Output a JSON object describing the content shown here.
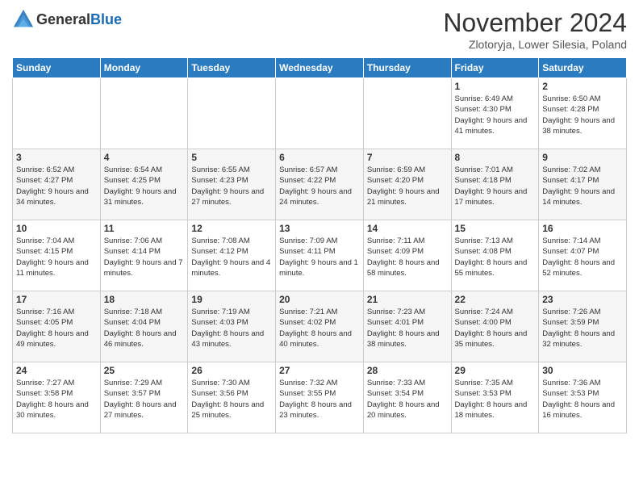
{
  "header": {
    "logo_general": "General",
    "logo_blue": "Blue",
    "month_title": "November 2024",
    "subtitle": "Zlotoryja, Lower Silesia, Poland"
  },
  "weekdays": [
    "Sunday",
    "Monday",
    "Tuesday",
    "Wednesday",
    "Thursday",
    "Friday",
    "Saturday"
  ],
  "weeks": [
    [
      {
        "day": "",
        "info": ""
      },
      {
        "day": "",
        "info": ""
      },
      {
        "day": "",
        "info": ""
      },
      {
        "day": "",
        "info": ""
      },
      {
        "day": "",
        "info": ""
      },
      {
        "day": "1",
        "info": "Sunrise: 6:49 AM\nSunset: 4:30 PM\nDaylight: 9 hours and 41 minutes."
      },
      {
        "day": "2",
        "info": "Sunrise: 6:50 AM\nSunset: 4:28 PM\nDaylight: 9 hours and 38 minutes."
      }
    ],
    [
      {
        "day": "3",
        "info": "Sunrise: 6:52 AM\nSunset: 4:27 PM\nDaylight: 9 hours and 34 minutes."
      },
      {
        "day": "4",
        "info": "Sunrise: 6:54 AM\nSunset: 4:25 PM\nDaylight: 9 hours and 31 minutes."
      },
      {
        "day": "5",
        "info": "Sunrise: 6:55 AM\nSunset: 4:23 PM\nDaylight: 9 hours and 27 minutes."
      },
      {
        "day": "6",
        "info": "Sunrise: 6:57 AM\nSunset: 4:22 PM\nDaylight: 9 hours and 24 minutes."
      },
      {
        "day": "7",
        "info": "Sunrise: 6:59 AM\nSunset: 4:20 PM\nDaylight: 9 hours and 21 minutes."
      },
      {
        "day": "8",
        "info": "Sunrise: 7:01 AM\nSunset: 4:18 PM\nDaylight: 9 hours and 17 minutes."
      },
      {
        "day": "9",
        "info": "Sunrise: 7:02 AM\nSunset: 4:17 PM\nDaylight: 9 hours and 14 minutes."
      }
    ],
    [
      {
        "day": "10",
        "info": "Sunrise: 7:04 AM\nSunset: 4:15 PM\nDaylight: 9 hours and 11 minutes."
      },
      {
        "day": "11",
        "info": "Sunrise: 7:06 AM\nSunset: 4:14 PM\nDaylight: 9 hours and 7 minutes."
      },
      {
        "day": "12",
        "info": "Sunrise: 7:08 AM\nSunset: 4:12 PM\nDaylight: 9 hours and 4 minutes."
      },
      {
        "day": "13",
        "info": "Sunrise: 7:09 AM\nSunset: 4:11 PM\nDaylight: 9 hours and 1 minute."
      },
      {
        "day": "14",
        "info": "Sunrise: 7:11 AM\nSunset: 4:09 PM\nDaylight: 8 hours and 58 minutes."
      },
      {
        "day": "15",
        "info": "Sunrise: 7:13 AM\nSunset: 4:08 PM\nDaylight: 8 hours and 55 minutes."
      },
      {
        "day": "16",
        "info": "Sunrise: 7:14 AM\nSunset: 4:07 PM\nDaylight: 8 hours and 52 minutes."
      }
    ],
    [
      {
        "day": "17",
        "info": "Sunrise: 7:16 AM\nSunset: 4:05 PM\nDaylight: 8 hours and 49 minutes."
      },
      {
        "day": "18",
        "info": "Sunrise: 7:18 AM\nSunset: 4:04 PM\nDaylight: 8 hours and 46 minutes."
      },
      {
        "day": "19",
        "info": "Sunrise: 7:19 AM\nSunset: 4:03 PM\nDaylight: 8 hours and 43 minutes."
      },
      {
        "day": "20",
        "info": "Sunrise: 7:21 AM\nSunset: 4:02 PM\nDaylight: 8 hours and 40 minutes."
      },
      {
        "day": "21",
        "info": "Sunrise: 7:23 AM\nSunset: 4:01 PM\nDaylight: 8 hours and 38 minutes."
      },
      {
        "day": "22",
        "info": "Sunrise: 7:24 AM\nSunset: 4:00 PM\nDaylight: 8 hours and 35 minutes."
      },
      {
        "day": "23",
        "info": "Sunrise: 7:26 AM\nSunset: 3:59 PM\nDaylight: 8 hours and 32 minutes."
      }
    ],
    [
      {
        "day": "24",
        "info": "Sunrise: 7:27 AM\nSunset: 3:58 PM\nDaylight: 8 hours and 30 minutes."
      },
      {
        "day": "25",
        "info": "Sunrise: 7:29 AM\nSunset: 3:57 PM\nDaylight: 8 hours and 27 minutes."
      },
      {
        "day": "26",
        "info": "Sunrise: 7:30 AM\nSunset: 3:56 PM\nDaylight: 8 hours and 25 minutes."
      },
      {
        "day": "27",
        "info": "Sunrise: 7:32 AM\nSunset: 3:55 PM\nDaylight: 8 hours and 23 minutes."
      },
      {
        "day": "28",
        "info": "Sunrise: 7:33 AM\nSunset: 3:54 PM\nDaylight: 8 hours and 20 minutes."
      },
      {
        "day": "29",
        "info": "Sunrise: 7:35 AM\nSunset: 3:53 PM\nDaylight: 8 hours and 18 minutes."
      },
      {
        "day": "30",
        "info": "Sunrise: 7:36 AM\nSunset: 3:53 PM\nDaylight: 8 hours and 16 minutes."
      }
    ]
  ]
}
